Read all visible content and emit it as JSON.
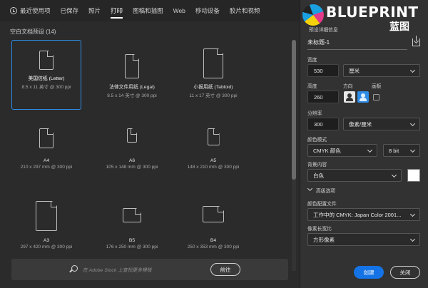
{
  "tabs": [
    {
      "label": "最近使用项",
      "icon": "clock-icon"
    },
    {
      "label": "已保存"
    },
    {
      "label": "照片"
    },
    {
      "label": "打印"
    },
    {
      "label": "图稿和插图"
    },
    {
      "label": "Web"
    },
    {
      "label": "移动设备"
    },
    {
      "label": "胶片和视频"
    }
  ],
  "active_tab": "打印",
  "section_title": "空白文档预设 (14)",
  "presets": [
    {
      "name": "美国信纸 (Letter)",
      "size": "8.5 x 11 英寸 @ 300 ppi",
      "selected": true
    },
    {
      "name": "法律文件用纸 (Legal)",
      "size": "8.5 x 14 英寸 @ 300 ppi"
    },
    {
      "name": "小报用纸 (Tabloid)",
      "size": "11 x 17 英寸 @ 300 ppi"
    },
    {
      "name": "A4",
      "size": "210 x 297 mm @ 300 ppi"
    },
    {
      "name": "A6",
      "size": "105 x 148 mm @ 300 ppi"
    },
    {
      "name": "A5",
      "size": "148 x 210 mm @ 300 ppi"
    },
    {
      "name": "A3",
      "size": "297 x 420 mm @ 300 ppi"
    },
    {
      "name": "B5",
      "size": "176 x 250 mm @ 300 ppi"
    },
    {
      "name": "B4",
      "size": "250 x 353 mm @ 300 ppi"
    }
  ],
  "search": {
    "placeholder": "在 Adobe Stock 上查找更多模板",
    "go_label": "前往"
  },
  "logo": {
    "text": "BLUEPRINT",
    "sub": "蓝图"
  },
  "details": {
    "preset_info_label": "预设详细信息",
    "doc_name": "未标题-1",
    "width_label": "宽度",
    "width_value": "530",
    "width_unit": "厘米",
    "height_label": "高度",
    "height_value": "260",
    "orientation_label": "方向",
    "artboard_label": "画板",
    "resolution_label": "分辨率",
    "resolution_value": "300",
    "resolution_unit": "像素/厘米",
    "color_mode_label": "颜色模式",
    "color_mode_value": "CMYK 颜色",
    "bit_depth": "8 bit",
    "bg_label": "背景内容",
    "bg_value": "白色",
    "bg_color": "#ffffff",
    "advanced_label": "高级选项",
    "color_profile_label": "颜色配置文件",
    "color_profile_value": "工作中的 CMYK: Japan Color 2001...",
    "pixel_ratio_label": "像素长宽比",
    "pixel_ratio_value": "方形像素",
    "create_label": "创建",
    "close_label": "关闭"
  },
  "colors": {
    "accent": "#1473e6",
    "selection": "#2e8ce6"
  }
}
